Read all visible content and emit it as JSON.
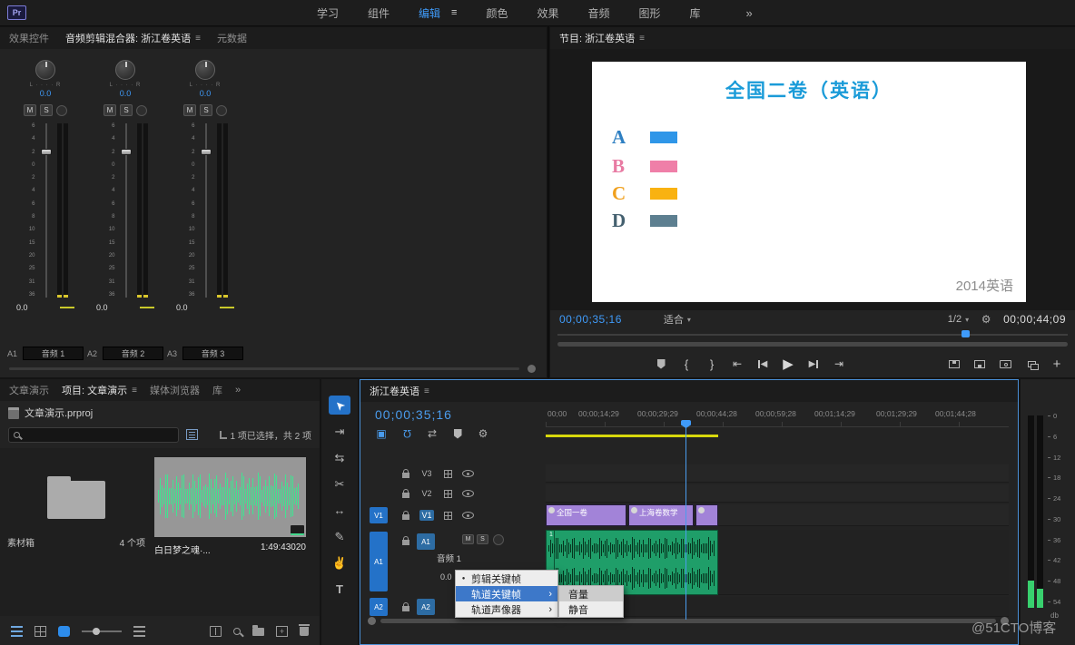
{
  "topbar": {
    "logo": "Pr",
    "menu": [
      {
        "label": "学习",
        "active": false
      },
      {
        "label": "组件",
        "active": false
      },
      {
        "label": "编辑",
        "active": true
      },
      {
        "label": "颜色",
        "active": false
      },
      {
        "label": "效果",
        "active": false
      },
      {
        "label": "音频",
        "active": false
      },
      {
        "label": "图形",
        "active": false
      },
      {
        "label": "库",
        "active": false
      },
      {
        "label": "»",
        "active": false
      }
    ]
  },
  "icons": {
    "panel_menu": "≡",
    "caret": "▾",
    "brace_in": "{",
    "brace_out": "}",
    "goto_in": "⇤",
    "goto_out": "⇥",
    "tri_left": "◀",
    "tri_right": "▶",
    "plus": "+",
    "bullet": "●",
    "submenu_arrow": "›",
    "nest": "▣",
    "magnet": "Ω",
    "link": "⇄",
    "wrench": "⚙"
  },
  "mixer": {
    "tabs": [
      {
        "label": "效果控件",
        "active": false
      },
      {
        "label": "音频剪辑混合器: 浙江卷英语",
        "active": true
      },
      {
        "label": "元数据",
        "active": false
      }
    ],
    "pan_scale": "L · · · · R",
    "mute": "M",
    "solo": "S",
    "scale": [
      "6",
      "4",
      "2",
      "0",
      "2",
      "4",
      "6",
      "8",
      "10",
      "15",
      "20",
      "25",
      "31",
      "36"
    ],
    "channels": [
      {
        "pan": "0.0",
        "db": "0.0",
        "track": "A1",
        "name": "音频 1"
      },
      {
        "pan": "0.0",
        "db": "0.0",
        "track": "A2",
        "name": "音频 2"
      },
      {
        "pan": "0.0",
        "db": "0.0",
        "track": "A3",
        "name": "音频 3"
      }
    ]
  },
  "program": {
    "tab": "节目: 浙江卷英语",
    "timecode": "00;00;35;16",
    "zoom": "适合",
    "resolution": "1/2",
    "duration": "00;00;44;09",
    "slide": {
      "title": "全国二卷（英语）",
      "title_color": "#1a9bd8",
      "options": [
        {
          "letter": "A",
          "letter_color": "#2e7fc2",
          "box_color": "#2f96e8"
        },
        {
          "letter": "B",
          "letter_color": "#e87ba3",
          "box_color": "#ef7fa8"
        },
        {
          "letter": "C",
          "letter_color": "#f0a01e",
          "box_color": "#f9b211"
        },
        {
          "letter": "D",
          "letter_color": "#44606f",
          "box_color": "#5d7f90"
        }
      ],
      "footer": "2014英语",
      "footer_color": "#8d8d8d"
    }
  },
  "project": {
    "tabs": [
      {
        "label": "文章演示",
        "active": false
      },
      {
        "label": "项目: 文章演示",
        "active": true
      },
      {
        "label": "媒体浏览器",
        "active": false
      },
      {
        "label": "库",
        "active": false
      },
      {
        "label": "»",
        "active": false
      }
    ],
    "file_name": "文章演示.prproj",
    "selection_info": "1 项已选择，共 2 项",
    "items": [
      {
        "name": "素材箱",
        "meta": "4 个项"
      },
      {
        "name": "白日梦之魂·...",
        "meta": "1:49:43020"
      }
    ]
  },
  "tools": [
    {
      "name": "selection-tool",
      "glyph": "➤",
      "active": true
    },
    {
      "name": "track-select-forward-tool",
      "glyph": "⇥",
      "active": false
    },
    {
      "name": "ripple-edit-tool",
      "glyph": "⇆",
      "active": false
    },
    {
      "name": "razor-tool",
      "glyph": "✂",
      "active": false
    },
    {
      "name": "slip-tool",
      "glyph": "↔",
      "active": false
    },
    {
      "name": "pen-tool",
      "glyph": "✎",
      "active": false
    },
    {
      "name": "hand-tool",
      "glyph": "✌",
      "active": false
    },
    {
      "name": "type-tool",
      "glyph": "T",
      "active": false
    }
  ],
  "timeline": {
    "tab": "浙江卷英语",
    "timecode": "00;00;35;16",
    "ruler": [
      "00;00",
      "00;00;14;29",
      "00;00;29;29",
      "00;00;44;28",
      "00;00;59;28",
      "00;01;14;29",
      "00;01;29;29",
      "00;01;44;28"
    ],
    "tracks": {
      "v3": "V3",
      "v2": "V2",
      "v1": "V1",
      "a1": "A1",
      "a2": "A2",
      "source_v1": "V1",
      "source_a1": "A1",
      "source_a2": "A2",
      "audio_name": "音频 1",
      "mute": "M",
      "solo": "S",
      "volume": "0.0"
    },
    "clips": {
      "video": [
        {
          "label": "全国一卷"
        },
        {
          "label": "上海卷数学"
        },
        {
          "label": ""
        }
      ],
      "audio_number": "1"
    },
    "menu": {
      "items": [
        {
          "label": "剪辑关键帧"
        },
        {
          "label": "轨道关键帧"
        },
        {
          "label": "轨道声像器"
        }
      ],
      "submenu": [
        {
          "label": "音量"
        },
        {
          "label": "静音"
        }
      ]
    }
  },
  "meters": {
    "scale": [
      "0",
      "6",
      "12",
      "18",
      "24",
      "30",
      "36",
      "42",
      "48",
      "54"
    ],
    "unit": "db"
  },
  "watermark": "@51CTO博客"
}
